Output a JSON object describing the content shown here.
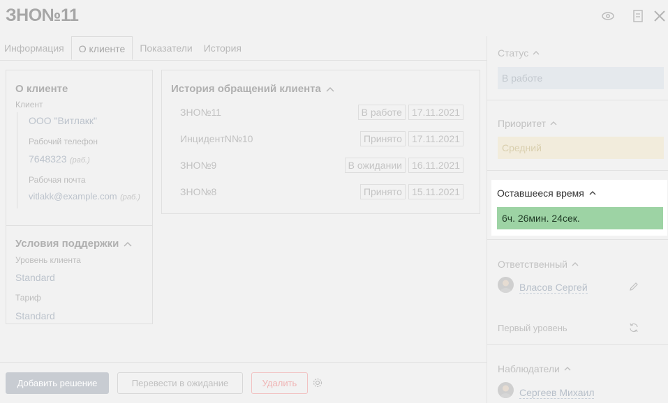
{
  "header": {
    "title": "ЗНО№11"
  },
  "tabs": [
    {
      "label": "Информация"
    },
    {
      "label": "О клиенте"
    },
    {
      "label": "Показатели"
    },
    {
      "label": "История"
    }
  ],
  "about": {
    "heading": "О клиенте",
    "client_label": "Клиент",
    "client_value": "ООО \"Витлакк\"",
    "phone_label": "Рабочий телефон",
    "phone_value": "7648323",
    "phone_tag": "(раб.)",
    "email_label": "Рабочая почта",
    "email_value": "vitlakk@example.com",
    "email_tag": "(раб.)"
  },
  "support": {
    "heading": "Условия поддержки",
    "level_label": "Уровень клиента",
    "level_value": "Standard",
    "tariff_label": "Тариф",
    "tariff_value": "Standard"
  },
  "history": {
    "heading": "История обращений клиента",
    "rows": [
      {
        "name": "ЗНО№11",
        "status": "В работе",
        "date": "17.11.2021"
      },
      {
        "name": "ИнцидентN№10",
        "status": "Принято",
        "date": "17.11.2021"
      },
      {
        "name": "ЗНО№9",
        "status": "В ожидании",
        "date": "16.11.2021"
      },
      {
        "name": "ЗНО№8",
        "status": "Принято",
        "date": "15.11.2021"
      }
    ]
  },
  "sidebar": {
    "status_label": "Статус",
    "status_value": "В работе",
    "priority_label": "Приоритет",
    "priority_value": "Средний",
    "remaining_label": "Оставшееся время",
    "remaining_value": "6ч. 26мин. 24сек.",
    "responsible_label": "Ответственный",
    "responsible_name": "Власов Сергей",
    "first_level": "Первый уровень",
    "watchers_label": "Наблюдатели",
    "watcher_name": "Сергеев Михаил"
  },
  "footer": {
    "add_solution": "Добавить решение",
    "to_waiting": "Перевести в ожидание",
    "delete": "Удалить"
  },
  "colors": {
    "timer_bg": "#9dd3a4",
    "status_bg": "#e5e9ed",
    "priority_bg": "#f2ecdc",
    "primary_btn": "#c8ccd2",
    "delete_border": "#f2c2c2"
  }
}
